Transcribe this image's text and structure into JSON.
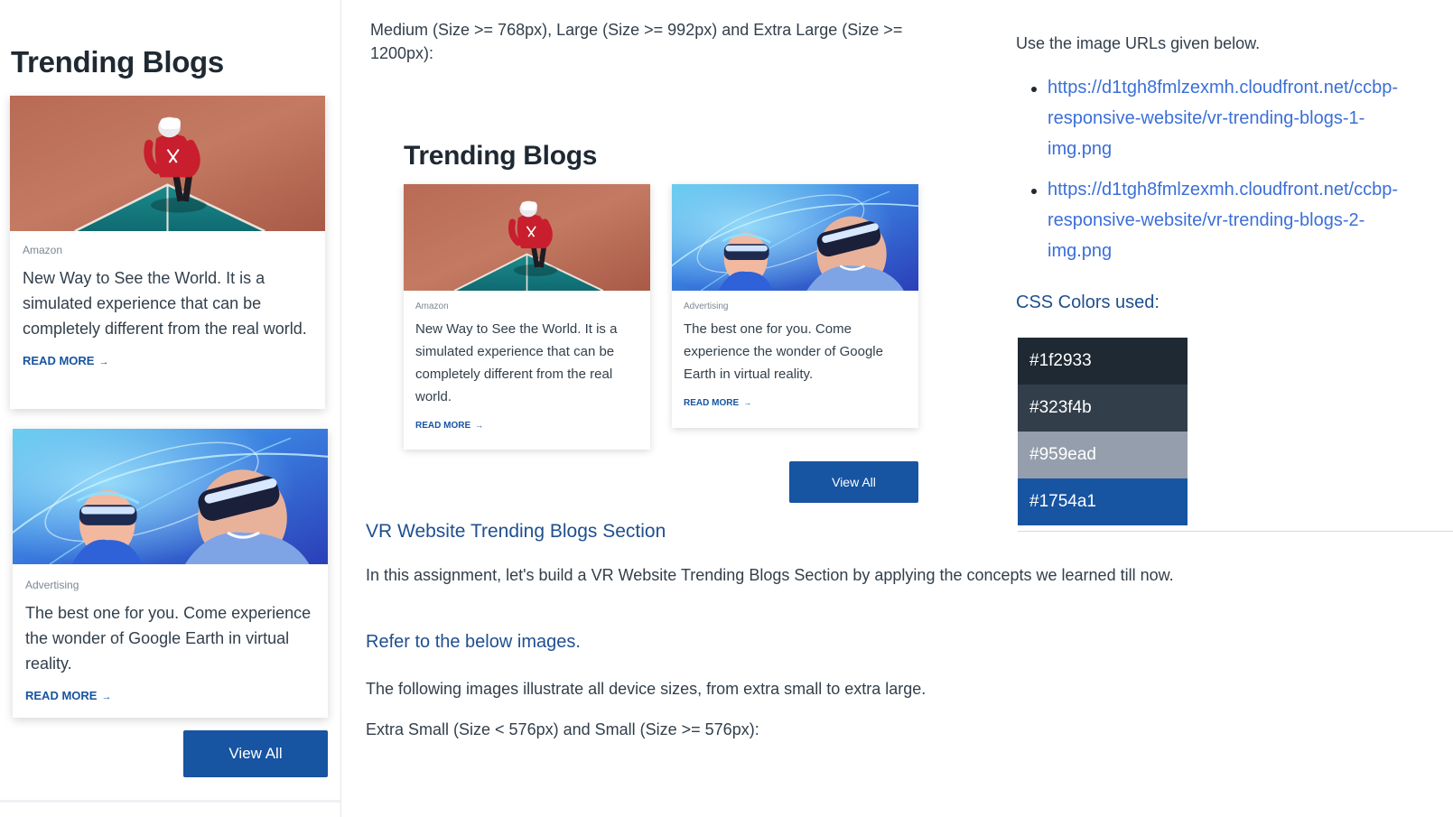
{
  "mobile_preview": {
    "heading": "Trending Blogs",
    "cards": [
      {
        "tag": "Amazon",
        "description": "New Way to See the World. It is a simulated experience that can be completely different from the real world.",
        "read_more": "READ MORE",
        "image": "vr-trending-blogs-1-img"
      },
      {
        "tag": "Advertising",
        "description": "The best one for you. Come experience the wonder of Google Earth in virtual reality.",
        "read_more": "READ MORE",
        "image": "vr-trending-blogs-2-img"
      }
    ],
    "view_all_label": "View All"
  },
  "desktop_preview": {
    "intro": "Medium (Size >= 768px), Large (Size >= 992px) and Extra Large (Size >= 1200px):",
    "heading": "Trending Blogs",
    "cards": [
      {
        "tag": "Amazon",
        "description": "New Way to See the World. It is a simulated experience that can be completely different from the real world.",
        "read_more": "READ MORE"
      },
      {
        "tag": "Advertising",
        "description": "The best one for you. Come experience the wonder of Google Earth in virtual reality.",
        "read_more": "READ MORE"
      }
    ],
    "view_all_label": "View All"
  },
  "assignment": {
    "title": "VR Website Trending Blogs Section",
    "intro": "In this assignment, let's build a VR Website Trending Blogs Section by applying the concepts we learned till now.",
    "refer_heading": "Refer to the below images.",
    "device_sizes_text": "The following images illustrate all device sizes, from extra small to extra large.",
    "small_sizes_label": "Extra Small (Size < 576px) and Small (Size >= 576px):"
  },
  "resources": {
    "image_urls_label": "Use the image URLs given below.",
    "urls": [
      {
        "line1": "https://d1tgh8fmlzexmh.cloudfront.net/ccbp-",
        "line2": "responsive-website/vr-trending-blogs-1-",
        "line3": "img.png"
      },
      {
        "line1": "https://d1tgh8fmlzexmh.cloudfront.net/ccbp-",
        "line2": "responsive-website/vr-trending-blogs-2-",
        "line3": "img.png"
      }
    ],
    "colors_heading": "CSS Colors used:",
    "colors": [
      {
        "label": "#1f2933",
        "hex": "#1f2933"
      },
      {
        "label": "#323f4b",
        "hex": "#323f4b"
      },
      {
        "label": "#959ead",
        "hex": "#959ead"
      },
      {
        "label": "#1754a1",
        "hex": "#1754a1"
      }
    ]
  }
}
